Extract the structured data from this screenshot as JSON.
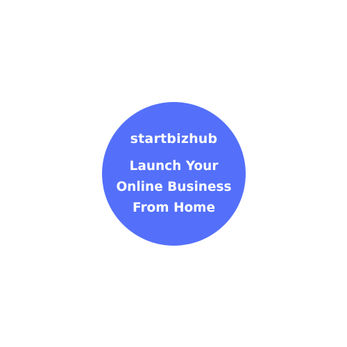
{
  "badge": {
    "brand": "startbizhub",
    "tagline_lines": [
      "Launch Your",
      "Online Business",
      "From Home"
    ],
    "fill_color": "#5470FA",
    "text_color": "#FFFFFF"
  }
}
